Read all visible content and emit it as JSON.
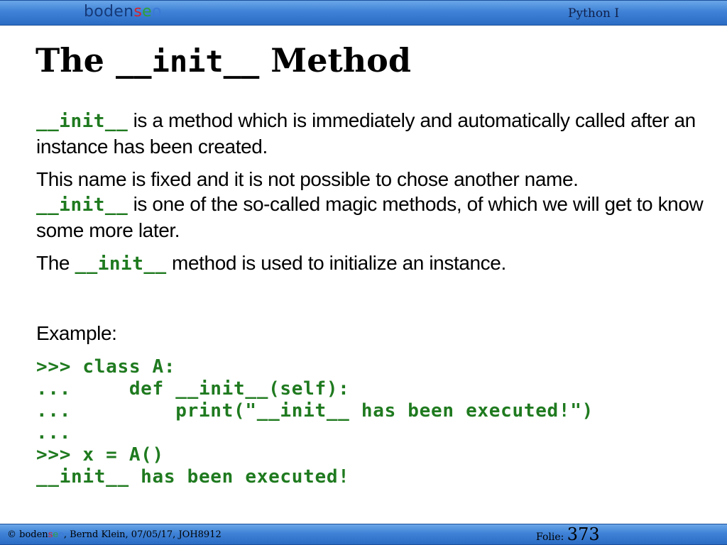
{
  "header": {
    "logo": {
      "part1": "boden",
      "s": "s",
      "e": "e",
      "o": "o"
    },
    "course": "Python I"
  },
  "slide": {
    "title_prefix": "The ",
    "title_code": "__init__",
    "title_suffix": " Method",
    "paragraphs": {
      "p1": {
        "code": "__init__",
        "text": " is a method which is immediately and automatically called after an instance has been created."
      },
      "p2": {
        "line1": "This name is fixed and it is not possible to chose another name.",
        "code": "__init__",
        "text": " is one of the so-called magic methods, of which we will get to know some more later."
      },
      "p3": {
        "before": "The ",
        "code": "__init__",
        "after": " method is used to initialize an instance."
      },
      "example_label": "Example:"
    },
    "code_lines": [
      ">>> class A:",
      "...     def __init__(self):",
      "...         print(\"__init__ has been executed!\")",
      "...",
      ">>> x = A()",
      "__init__ has been executed!"
    ]
  },
  "footer": {
    "copyright": "© ",
    "logo_part1": "boden",
    "logo_s": "s",
    "logo_e": "e",
    "logo_o": "o",
    "author_date": ", Bernd Klein, 07/05/17, JOH8912",
    "folie_label": "Folie: ",
    "folie_number": "373"
  },
  "colors": {
    "bar": "#3f82d6",
    "code_green": "#1f7a1f",
    "logo_red": "#d8232a",
    "logo_green": "#2fa03a",
    "logo_blue": "#3b78d8"
  }
}
